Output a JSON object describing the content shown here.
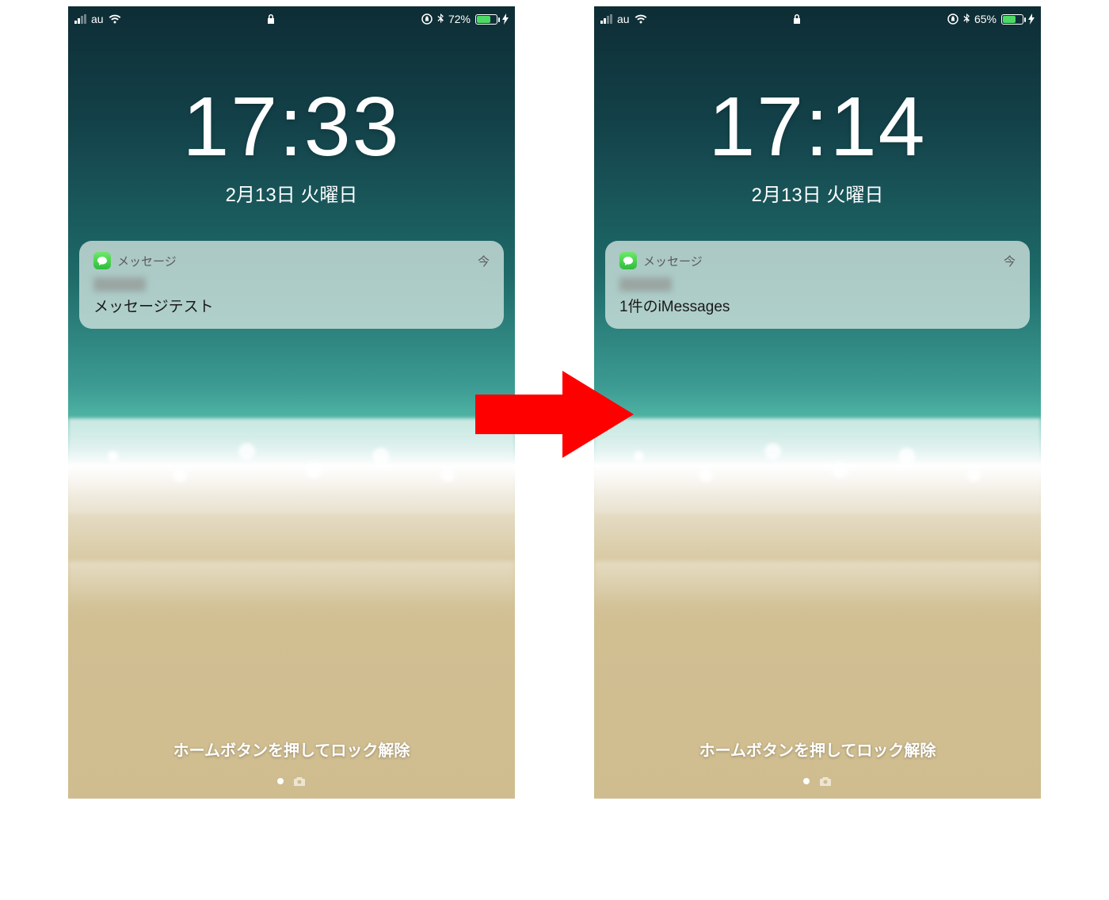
{
  "arrow_color": "#ff0000",
  "screens": [
    {
      "status": {
        "carrier": "au",
        "signal_bars_on": 2,
        "battery_text": "72%",
        "battery_pct": 72
      },
      "clock": "17:33",
      "date": "2月13日 火曜日",
      "notification": {
        "app_name": "メッセージ",
        "timestamp": "今",
        "body": "メッセージテスト"
      },
      "unlock_hint": "ホームボタンを押してロック解除"
    },
    {
      "status": {
        "carrier": "au",
        "signal_bars_on": 2,
        "battery_text": "65%",
        "battery_pct": 65
      },
      "clock": "17:14",
      "date": "2月13日 火曜日",
      "notification": {
        "app_name": "メッセージ",
        "timestamp": "今",
        "body": "1件のiMessages"
      },
      "unlock_hint": "ホームボタンを押してロック解除"
    }
  ]
}
